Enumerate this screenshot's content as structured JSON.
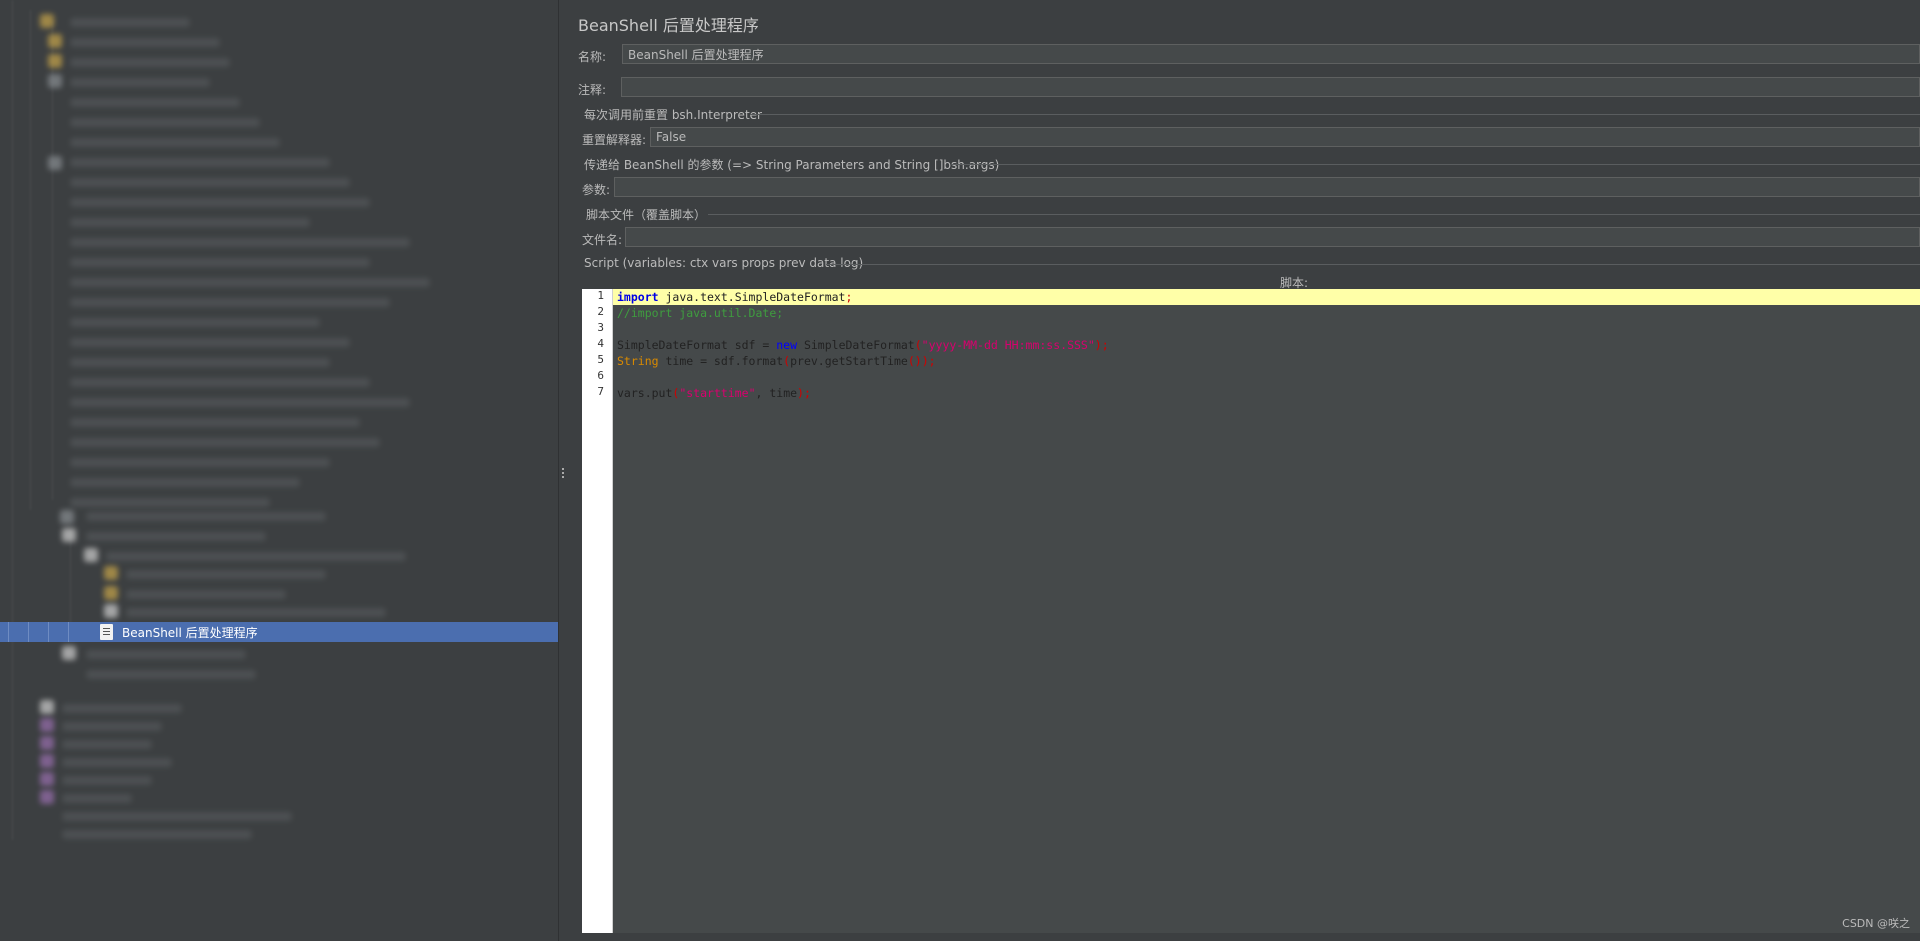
{
  "tree": {
    "selected_item": "BeanShell 后置处理程序"
  },
  "panel": {
    "title": "BeanShell 后置处理程序",
    "name_label": "名称:",
    "name_value": "BeanShell 后置处理程序",
    "comment_label": "注释:",
    "comment_value": "",
    "reset_section": "每次调用前重置 bsh.Interpreter",
    "reset_label": "重置解释器:",
    "reset_value": "False",
    "params_section": "传递给 BeanShell 的参数 (=> String Parameters and String []bsh.args)",
    "params_label": "参数:",
    "params_value": "",
    "file_section": "脚本文件（覆盖脚本）",
    "file_label": "文件名:",
    "file_value": "",
    "script_section": "Script (variables: ctx vars props prev data log)",
    "script_label": "脚本:"
  },
  "editor": {
    "line_numbers": [
      "1",
      "2",
      "3",
      "4",
      "5",
      "6",
      "7"
    ],
    "lines": [
      "import java.text.SimpleDateFormat;",
      "//import java.util.Date;",
      "",
      "SimpleDateFormat sdf = new SimpleDateFormat(\"yyyy-MM-dd HH:mm:ss.SSS\");",
      "String time = sdf.format(prev.getStartTime());",
      "",
      "vars.put(\"starttime\", time);"
    ]
  },
  "watermark": "CSDN @咲之"
}
